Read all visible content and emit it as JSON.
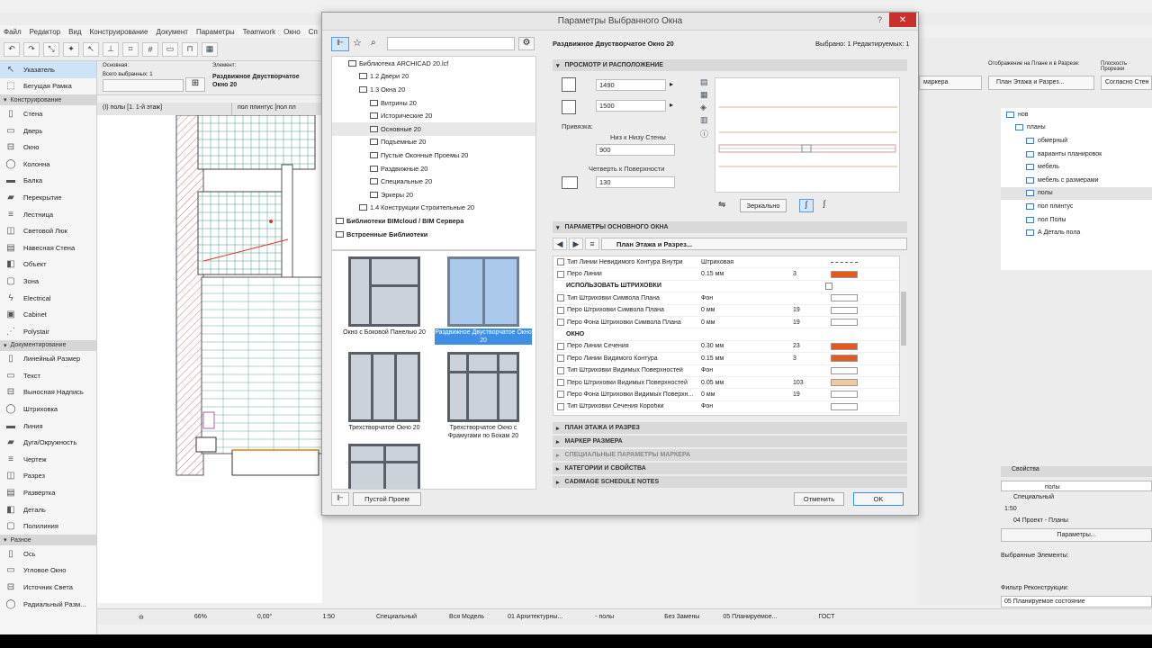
{
  "menu": [
    "Файл",
    "Редактор",
    "Вид",
    "Конструирование",
    "Документ",
    "Параметры",
    "Teamwork",
    "Окно",
    "Сп"
  ],
  "toolbox": {
    "items_top": [
      {
        "label": "Указатель",
        "icon": "pointer-icon",
        "selected": true
      },
      {
        "label": "Бегущая Рамка",
        "icon": "marquee-icon"
      }
    ],
    "sections": [
      {
        "title": "Конструирование",
        "items": [
          "Стена",
          "Дверь",
          "Окно",
          "Колонна",
          "Балка",
          "Перекрытие",
          "Лестница",
          "Световой Люк",
          "Навесная Стена",
          "Объект",
          "Зона",
          "Electrical",
          "Cabinet",
          "Polystair"
        ]
      },
      {
        "title": "Документирование",
        "items": [
          "Линейный Размер",
          "Текст",
          "Выносная Надпись",
          "Штриховка",
          "Линия",
          "Дуга/Окружность",
          "Чертеж",
          "Разрез",
          "Развертка",
          "Деталь",
          "Полилиния"
        ]
      },
      {
        "title": "Разное",
        "items": [
          "Ось",
          "Угловое Окно",
          "Источник Света",
          "Радиальный Разм..."
        ]
      }
    ]
  },
  "infobox": {
    "basic_label": "Основная:",
    "all_selected": "Всего выбранных: 1",
    "element_label": "Элемент:",
    "element_name": "Раздвижное Двустворчатое Окно 20"
  },
  "tabs": [
    "(I) полы [1. 1-й этаж]",
    "пол плинтус [пол пл"
  ],
  "dialog": {
    "title": "Параметры Выбранного Окна",
    "help": "?",
    "close": "✕",
    "object_name": "Раздвижное Двустворчатое Окно 20",
    "selected_info": "Выбрано: 1 Редактируемых: 1",
    "tree": [
      {
        "label": "Библиотека ARCHICAD 20.lcf",
        "level": 1
      },
      {
        "label": "1.2 Двери 20",
        "level": 2
      },
      {
        "label": "1.3 Окна 20",
        "level": 2
      },
      {
        "label": "Витрины 20",
        "level": 3
      },
      {
        "label": "Исторические 20",
        "level": 3
      },
      {
        "label": "Основные 20",
        "level": 3
      },
      {
        "label": "Подъемные 20",
        "level": 3
      },
      {
        "label": "Пустые Оконные Проемы 20",
        "level": 3
      },
      {
        "label": "Раздвижные 20",
        "level": 3
      },
      {
        "label": "Специальные 20",
        "level": 3
      },
      {
        "label": "Эркеры 20",
        "level": 3
      },
      {
        "label": "1.4 Конструкции Строительные 20",
        "level": 2
      },
      {
        "label": "Библиотеки BIMcloud / BIM Сервера",
        "level": 0
      },
      {
        "label": "Встроенные Библиотеки",
        "level": 0
      }
    ],
    "gallery": [
      {
        "label": "Окно с Боковой Панелью 20",
        "selected": false
      },
      {
        "label": "Раздвижное Двустворчатое Окно 20",
        "selected": true
      },
      {
        "label": "Трехстворчатое Окно 20",
        "selected": false
      },
      {
        "label": "Трехстворчатое Окно с Фрамугами по Бокам 20",
        "selected": false
      }
    ],
    "empty_opening_btn": "Пустой Проем",
    "sections": {
      "view": "Просмотр и Расположение",
      "main": "Параметры Основного Окна",
      "floorplan": "План Этажа и Разрез",
      "dim_marker": "Маркер Размера",
      "special_marker": "Специальные Параметры Маркера",
      "categories": "Категории и Свойства",
      "cadimage": "CADIMAGE SCHEDULE NOTES"
    },
    "width": "1490",
    "height": "1500",
    "anchor_label": "Привязка:",
    "anchor_mode": "Низ к Низу Стены",
    "anchor_value": "900",
    "reveal_label": "Четверть к Поверхности",
    "reveal_value": "130",
    "mirror_btn": "Зеркально",
    "panel_dropdown": "План Этажа и Разрез...",
    "params": [
      {
        "name": "Тип Линии Невидимого Контура Внутри",
        "value": "Штриховая",
        "pen": "",
        "type": "line"
      },
      {
        "name": "Перо Линии",
        "value": "0.15 мм",
        "pen": "3",
        "type": "pen",
        "color": "#e35a1c"
      },
      {
        "name": "Использовать Штриховки",
        "value": "",
        "pen": "",
        "type": "group-check"
      },
      {
        "name": "Тип Штриховки Символа Плана",
        "value": "Фон",
        "pen": "",
        "type": "fill"
      },
      {
        "name": "Перо Штриховки Символа Плана",
        "value": "0 мм",
        "pen": "19",
        "type": "pen",
        "color": "#ffffff"
      },
      {
        "name": "Перо Фона Штриховки Символа Плана",
        "value": "0 мм",
        "pen": "19",
        "type": "pen",
        "color": "#ffffff"
      },
      {
        "name": "Окно",
        "value": "",
        "pen": "",
        "type": "group"
      },
      {
        "name": "Перо Линии Сечения",
        "value": "0.30 мм",
        "pen": "23",
        "type": "pen",
        "color": "#e35a1c"
      },
      {
        "name": "Перо Линии Видимого Контура",
        "value": "0.15 мм",
        "pen": "3",
        "type": "pen",
        "color": "#e35a1c"
      },
      {
        "name": "Тип Штриховки Видимых Поверхностей",
        "value": "Фон",
        "pen": "",
        "type": "fill"
      },
      {
        "name": "Перо Штриховки Видимых Поверхностей",
        "value": "0.05 мм",
        "pen": "103",
        "type": "pen",
        "color": "#f3c9a2"
      },
      {
        "name": "Перо Фона Штриховки Видимых Поверхн...",
        "value": "0 мм",
        "pen": "19",
        "type": "pen",
        "color": "#ffffff"
      },
      {
        "name": "Тип Штриховки Сечения Коробки",
        "value": "Фон",
        "pen": "",
        "type": "fill"
      }
    ],
    "cancel": "Отменить",
    "ok": "OK"
  },
  "right_panel": {
    "view_label": "Отображение на Плане и в Разрезе:",
    "view_value": "План Этажа и Разрез...",
    "cut_plane_label": "Плоскость Прорезки",
    "cut_plane_value": "Согласно Стен",
    "marker_value": "маркера",
    "navigator": [
      "нов",
      "планы",
      "обмерный",
      "варианты планировок",
      "мебель",
      "мебель с размерами",
      "полы",
      "пол плинтус",
      "пол Полы",
      "А Деталь пола"
    ],
    "props_title": "Свойства",
    "props_name": "полы",
    "props_type": "Специальный",
    "props_scale": "1:50",
    "props_layer": "04 Проект - Планы",
    "params_btn": "Параметры...",
    "selected_title": "Выбранные Элементы:",
    "reno_title": "Фильтр Реконструкции:",
    "reno_value": "05 Планируемое состояние"
  },
  "status": [
    "66%",
    "0,00°",
    "1:50",
    "Специальный",
    "Вся Модель",
    "01 Архитектурны...",
    "- полы",
    "Без Замены",
    "05 Планируемое...",
    "ГОСТ"
  ],
  "colors": {
    "accent": "#3d8ee6",
    "pen_orange": "#e35a1c",
    "close_red": "#c7302b"
  }
}
